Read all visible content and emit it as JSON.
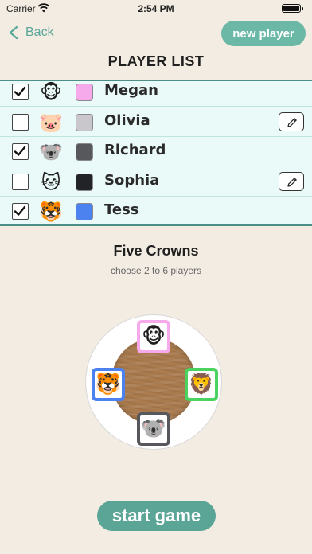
{
  "status_bar": {
    "carrier": "Carrier",
    "time": "2:54 PM"
  },
  "nav": {
    "back_label": "Back",
    "new_player_label": "new player"
  },
  "title": "PLAYER LIST",
  "players": [
    {
      "name": "Megan",
      "emoji": "🐵",
      "color": "#f7aaeb",
      "checked": true,
      "editable": false
    },
    {
      "name": "Olivia",
      "emoji": "🐷",
      "color": "#c9c7cc",
      "checked": false,
      "editable": true
    },
    {
      "name": "Richard",
      "emoji": "🐨",
      "color": "#57585c",
      "checked": true,
      "editable": false
    },
    {
      "name": "Sophia",
      "emoji": "🐱",
      "color": "#222326",
      "checked": false,
      "editable": true
    },
    {
      "name": "Tess",
      "emoji": "🐯",
      "color": "#4c82f0",
      "checked": true,
      "editable": false
    }
  ],
  "game": {
    "title": "Five Crowns",
    "subtitle": "choose 2 to 6 players"
  },
  "seats": [
    {
      "emoji": "🐵",
      "color": "#f7aaeb",
      "position": "top"
    },
    {
      "emoji": "🦁",
      "color": "#4bd35f",
      "position": "right"
    },
    {
      "emoji": "🐨",
      "color": "#57585c",
      "position": "bottom"
    },
    {
      "emoji": "🐯",
      "color": "#4c82f0",
      "position": "left"
    }
  ],
  "start_label": "start game"
}
